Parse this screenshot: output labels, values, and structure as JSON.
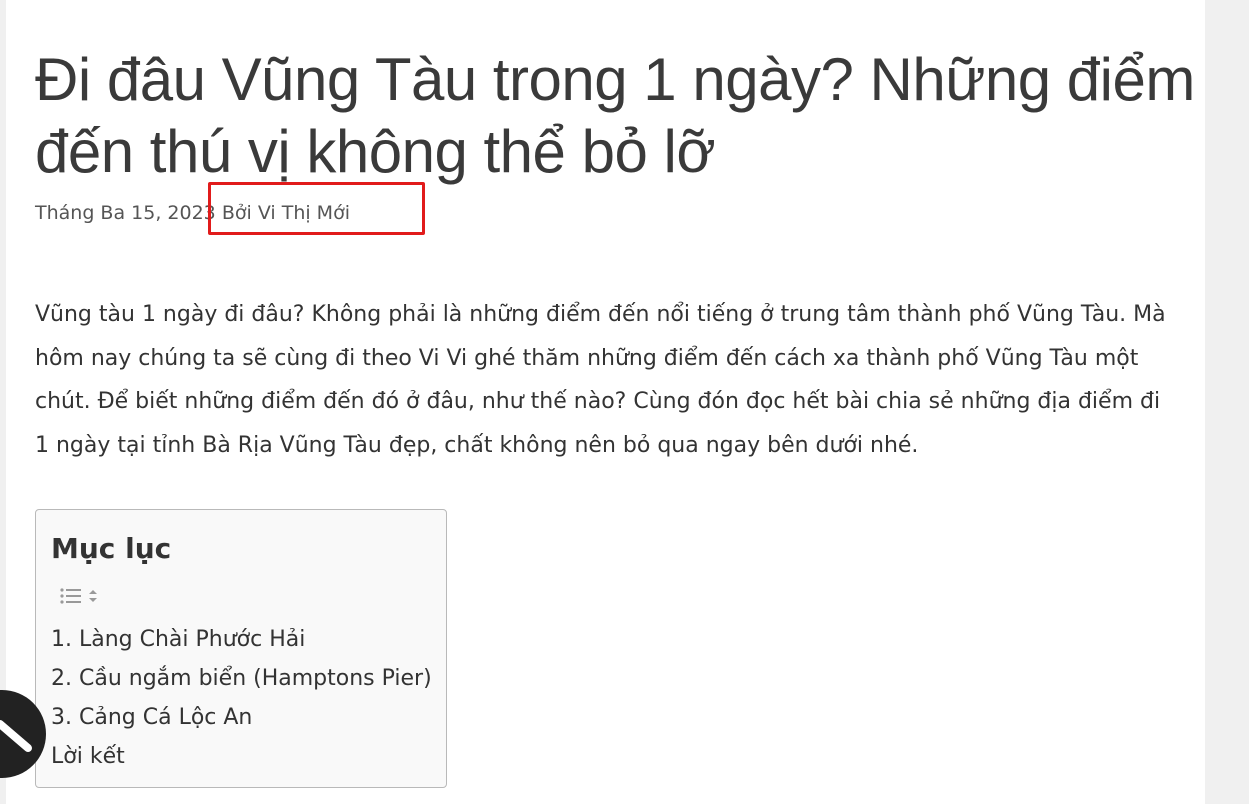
{
  "article": {
    "title": "Đi đâu Vũng Tàu trong 1 ngày? Những điểm đến thú vị không thể bỏ lỡ",
    "date": "Tháng Ba 15, 2023",
    "author_prefix": "Bởi",
    "author": "Vi Thị Mới",
    "intro": "Vũng tàu 1 ngày đi đâu? Không phải là những điểm đến nổi tiếng ở trung tâm thành phố Vũng Tàu. Mà hôm nay chúng ta sẽ cùng đi theo Vi Vi ghé thăm những điểm đến cách xa thành phố Vũng Tàu một chút. Để biết những điểm đến đó ở đâu, như thế nào? Cùng đón đọc hết bài chia sẻ những địa điểm đi 1 ngày tại tỉnh Bà Rịa Vũng Tàu đẹp, chất không nên bỏ qua ngay bên dưới nhé."
  },
  "toc": {
    "title": "Mục lục",
    "toggle_icon": "list-toggle-icon",
    "items": [
      {
        "label": "1. Làng Chài Phước Hải"
      },
      {
        "label": "2. Cầu ngắm biển (Hamptons Pier)"
      },
      {
        "label": "3. Cảng Cá Lộc An"
      },
      {
        "label": "Lời kết"
      }
    ]
  },
  "colors": {
    "highlight": "#e11b1b",
    "text": "#333333",
    "toc_bg": "#f9f9f9"
  }
}
